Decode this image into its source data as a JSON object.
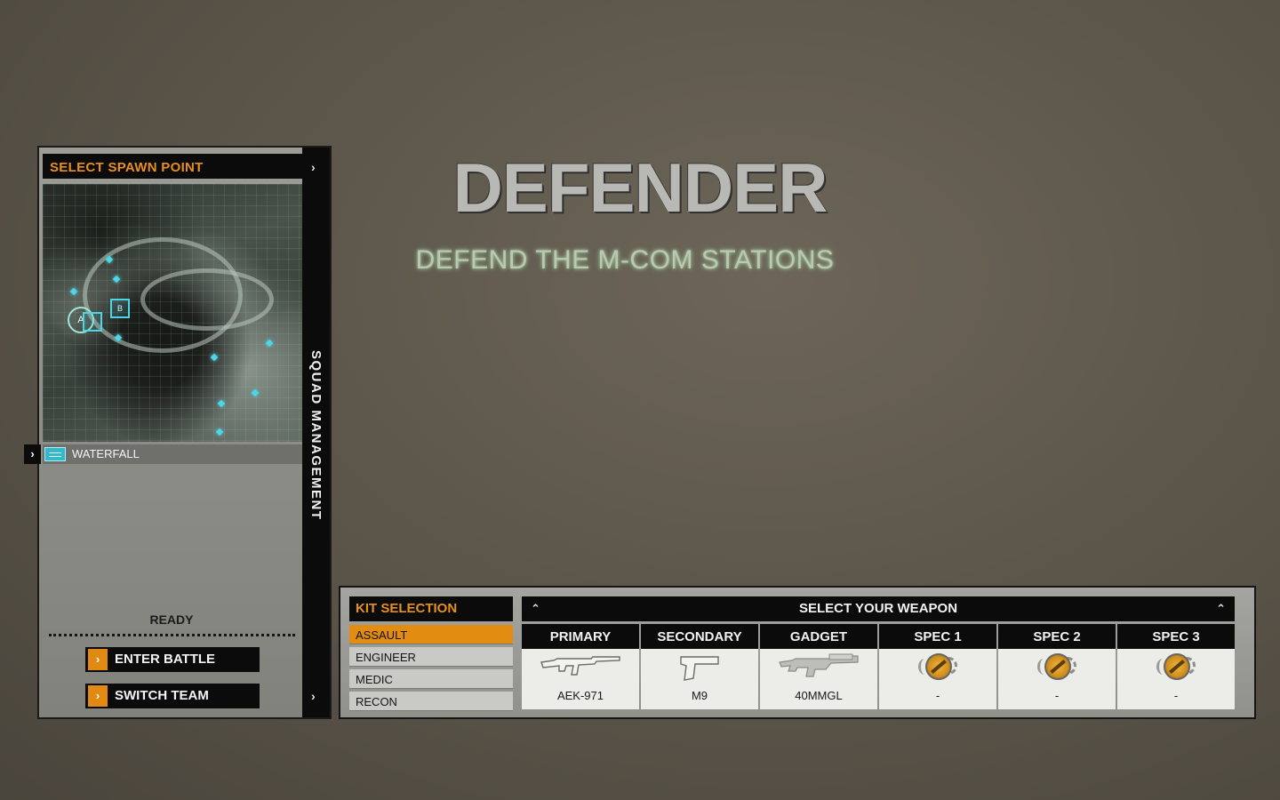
{
  "spawn": {
    "header": "SELECT SPAWN POINT",
    "spawn_points": [
      {
        "label": "WATERFALL",
        "selected": true
      }
    ],
    "side_label": "SQUAD MANAGEMENT",
    "status": "READY",
    "buttons": {
      "enter_battle": "ENTER BATTLE",
      "switch_team": "SWITCH TEAM"
    },
    "map_markers": {
      "objective": "A",
      "squad": "B"
    }
  },
  "objective": {
    "title": "DEFENDER",
    "subtitle": "DEFEND THE M-COM STATIONS"
  },
  "kits": {
    "header": "KIT SELECTION",
    "items": [
      "ASSAULT",
      "ENGINEER",
      "MEDIC",
      "RECON"
    ],
    "selected": "ASSAULT"
  },
  "weapons": {
    "header": "SELECT YOUR WEAPON",
    "slots": [
      {
        "label": "PRIMARY",
        "item": "AEK-971",
        "icon": "assault-rifle-icon"
      },
      {
        "label": "SECONDARY",
        "item": "M9",
        "icon": "pistol-icon"
      },
      {
        "label": "GADGET",
        "item": "40MMGL",
        "icon": "grenade-launcher-icon"
      },
      {
        "label": "SPEC 1",
        "item": "-",
        "icon": "locked-spec-icon"
      },
      {
        "label": "SPEC 2",
        "item": "-",
        "icon": "locked-spec-icon"
      },
      {
        "label": "SPEC 3",
        "item": "-",
        "icon": "locked-spec-icon"
      }
    ]
  },
  "colors": {
    "accent": "#e28c12",
    "panel_dark": "#0b0b0b",
    "map_highlight": "#4fd5e6"
  }
}
